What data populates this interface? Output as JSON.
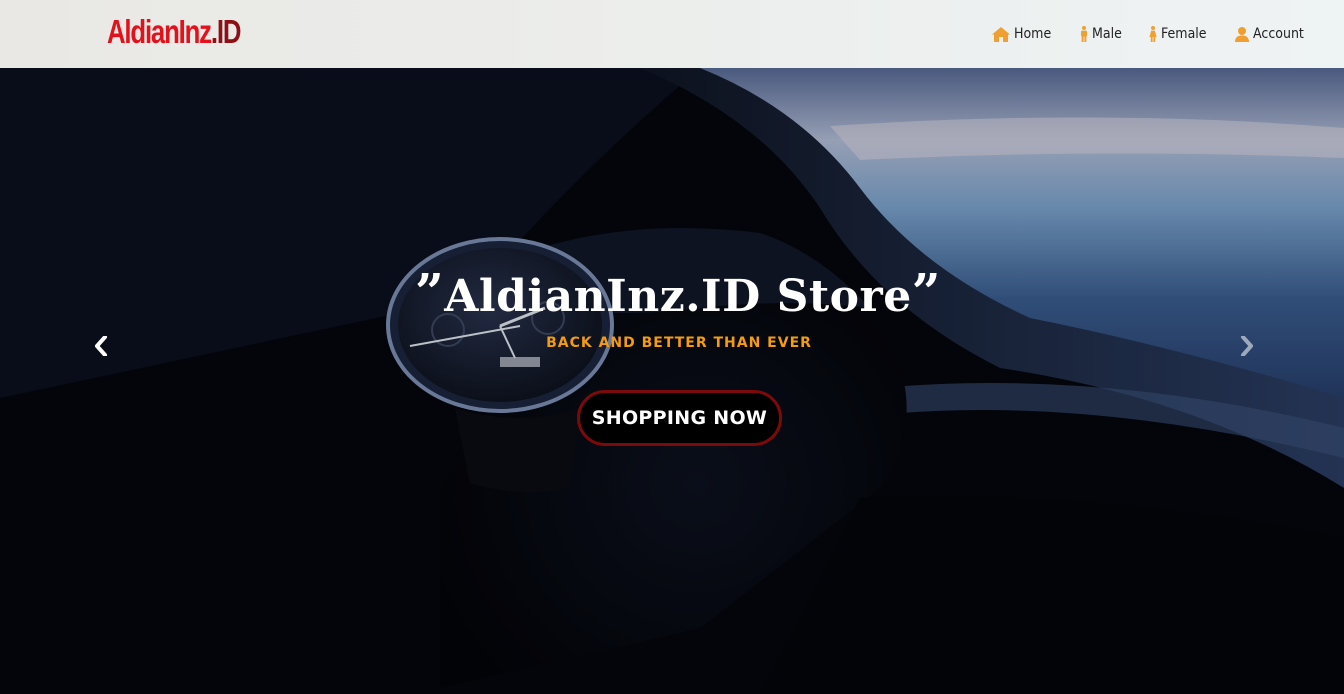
{
  "brand": {
    "name": "AldianInz",
    "suffix": ".ID"
  },
  "nav": {
    "items": [
      {
        "label": "Home",
        "icon": "home-icon"
      },
      {
        "label": "Male",
        "icon": "male-icon"
      },
      {
        "label": "Female",
        "icon": "female-icon"
      },
      {
        "label": "Account",
        "icon": "user-icon"
      }
    ]
  },
  "hero": {
    "quote_open": "”",
    "title": "AldianInz.ID Store",
    "quote_close": "”",
    "subtitle": "BACK AND BETTER THAN EVER",
    "cta_label": "SHOPPING NOW",
    "prev_icon": "chevron-left-icon",
    "next_icon": "chevron-right-icon"
  },
  "colors": {
    "brand_primary": "#e3111b",
    "brand_dark": "#8e0f14",
    "nav_icon": "#f0a030",
    "subtitle": "#f39c12",
    "cta_border": "#7d0a0a"
  }
}
